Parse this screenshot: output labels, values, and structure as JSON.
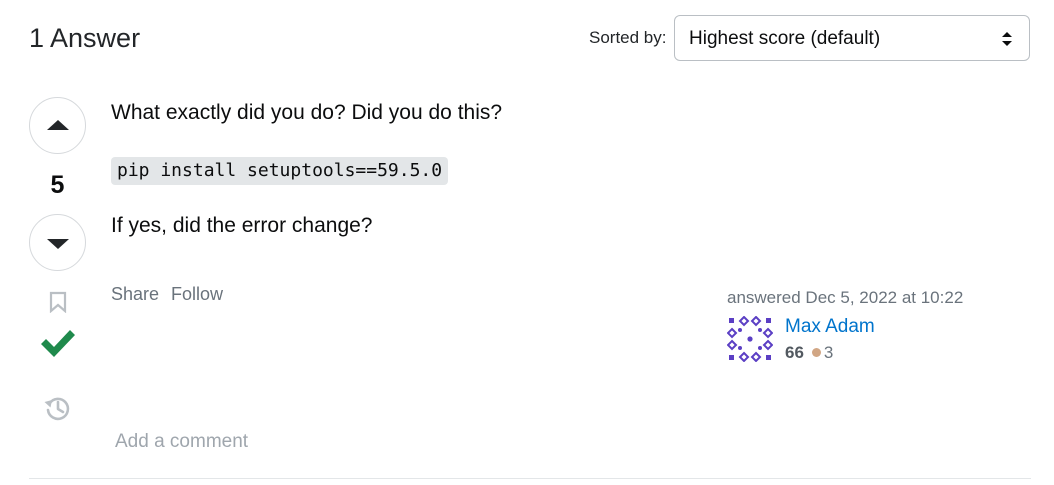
{
  "header": {
    "title": "1 Answer",
    "sort_label": "Sorted by:",
    "sort_value": "Highest score (default)"
  },
  "answer": {
    "vote_count": "5",
    "accepted": true,
    "body": {
      "paragraph1": "What exactly did you do? Did you do this?",
      "code": "pip install setuptools==59.5.0",
      "paragraph2": "If yes, did the error change?"
    },
    "menu": {
      "share_label": "Share",
      "follow_label": "Follow"
    },
    "user": {
      "action_time": "answered Dec 5, 2022 at 10:22",
      "name": "Max Adam",
      "reputation": "66",
      "bronze_badges": "3"
    },
    "add_comment_label": "Add a comment"
  },
  "colors": {
    "accent_link": "#0074cc",
    "accepted_green": "#1f8a4c",
    "bronze_badge": "#d1a684",
    "identicon": "#5b3fc4"
  },
  "icons": {
    "sort": "sort-caret-icon",
    "upvote": "arrow-up-icon",
    "downvote": "arrow-down-icon",
    "bookmark": "bookmark-icon",
    "accepted": "checkmark-icon",
    "history": "history-icon"
  }
}
